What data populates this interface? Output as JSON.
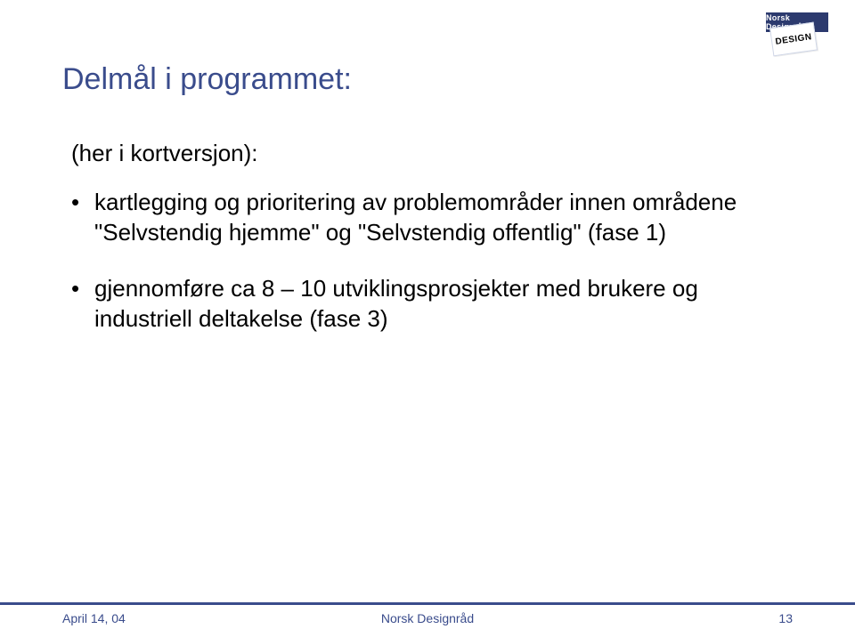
{
  "title": "Delmål i programmet:",
  "subtitle": "(her i kortversjon):",
  "bullets": [
    "kartlegging  og prioritering av problemområder innen områdene \"Selvstendig hjemme\" og \"Selvstendig offentlig\" (fase 1)",
    "gjennomføre ca 8 – 10 utviklingsprosjekter med brukere og industriell deltakelse (fase 3)"
  ],
  "footer": {
    "left": "April 14, 04",
    "center": "Norsk Designråd",
    "right": "13"
  },
  "logo": {
    "back": "Norsk Designråd",
    "front": "DESIGN"
  }
}
